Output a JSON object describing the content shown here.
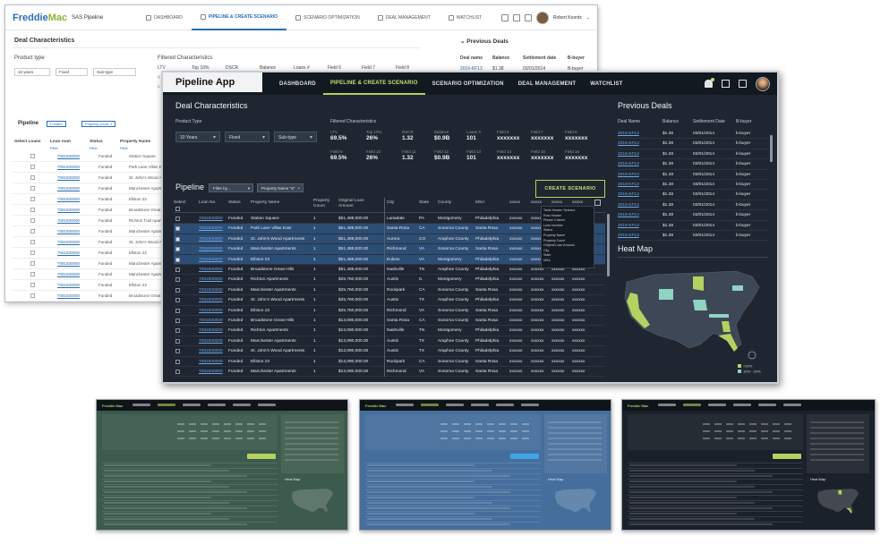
{
  "light_app": {
    "logo_a": "Freddie",
    "logo_b": "Mac",
    "app_name": "SAS Pipeline",
    "nav": [
      "DASHBOARD",
      "PIPELINE & CREATE SCENARIO",
      "SCENARIO OPTIMIZATION",
      "DEAL MANAGEMENT",
      "WATCHLIST"
    ],
    "user": "Robert Koontz",
    "deal_characteristics": "Deal Characteristics",
    "product_type": "Product type",
    "selects": [
      "10 years",
      "Fixed",
      "Sub-type"
    ],
    "filtered_characteristics": "Filtered Characteristics",
    "fc_labels": [
      "LTV",
      "Top 10%",
      "DSCR",
      "Balance",
      "Loans #",
      "Field 6",
      "Field 7",
      "Field 8"
    ],
    "previous_deals": "Previous Deals",
    "pd_headers": [
      "Deal name",
      "Balance",
      "Settlement date",
      "B-buyer"
    ],
    "pd_row": [
      "2016-KF13",
      "$1.38",
      "03/01/2014",
      "B-buyer"
    ],
    "pipeline": "Pipeline",
    "chips": [
      "Funded",
      "Property count: 1"
    ],
    "table_headers": [
      "Select Loans",
      "Loan num",
      "Status",
      "Property Name"
    ],
    "filter_label": "Filter",
    "rows": [
      {
        "ln": "7081500000",
        "st": "Funded",
        "pn": "Station Square"
      },
      {
        "ln": "7081500000",
        "st": "Funded",
        "pn": "Park Lane Villas East"
      },
      {
        "ln": "7081500000",
        "st": "Funded",
        "pn": "St. John's Wood Apartme"
      },
      {
        "ln": "7081500000",
        "st": "Funded",
        "pn": "Manchester Apartments"
      },
      {
        "ln": "7081500000",
        "st": "Funded",
        "pn": "Ellston 23"
      },
      {
        "ln": "7081500000",
        "st": "Funded",
        "pn": "Broadstone Great Hills"
      },
      {
        "ln": "7081500000",
        "st": "Funded",
        "pn": "Richton Trail Apartments"
      },
      {
        "ln": "7081500000",
        "st": "Funded",
        "pn": "Manchester Apartments"
      },
      {
        "ln": "7081500000",
        "st": "Funded",
        "pn": "St. John's Wood Apartme"
      },
      {
        "ln": "7081500000",
        "st": "Funded",
        "pn": "Ellston 23"
      },
      {
        "ln": "7081500000",
        "st": "Funded",
        "pn": "Manchester Apartments"
      },
      {
        "ln": "7081500000",
        "st": "Funded",
        "pn": "Manchester Apartments"
      },
      {
        "ln": "7081500000",
        "st": "Funded",
        "pn": "Ellston 23"
      },
      {
        "ln": "7081500000",
        "st": "Funded",
        "pn": "Broadstone Great Hills"
      }
    ]
  },
  "app": {
    "title_box": "Pipeline App",
    "nav": [
      "DASHBOARD",
      "PIPELINE & CREATE SCENARIO",
      "SCENARIO OPTIMIZATION",
      "DEAL MANAGEMENT",
      "WATCHLIST"
    ],
    "deal_characteristics": "Deal Characteristics",
    "product_type": "Product Type",
    "dropdowns": [
      "10 Years",
      "Fixed",
      "Sub-type"
    ],
    "filtered_characteristics": "Filtered Characteristics",
    "fc_row1": [
      {
        "k": "LTV",
        "v": "69.5%"
      },
      {
        "k": "Top 10%",
        "v": "26%"
      },
      {
        "k": "DSCR",
        "v": "1.32"
      },
      {
        "k": "Balance",
        "v": "$0.9B"
      },
      {
        "k": "Loans #",
        "v": "101"
      },
      {
        "k": "Field 6",
        "v": "xxxxxxx"
      },
      {
        "k": "Field 7",
        "v": "xxxxxxx"
      },
      {
        "k": "Field 8",
        "v": "xxxxxxx"
      }
    ],
    "fc_row2": [
      {
        "k": "Field 9",
        "v": "69.5%"
      },
      {
        "k": "Field 10",
        "v": "26%"
      },
      {
        "k": "Field 11",
        "v": "1.32"
      },
      {
        "k": "Field 12",
        "v": "$0.9B"
      },
      {
        "k": "Field 13",
        "v": "101"
      },
      {
        "k": "Field 14",
        "v": "xxxxxxx"
      },
      {
        "k": "Field 15",
        "v": "xxxxxxx"
      },
      {
        "k": "Field 16",
        "v": "xxxxxxx"
      }
    ],
    "pipeline": "Pipeline",
    "filter_by": "Filter by...",
    "chip": "Property Name \"S\"",
    "create_scenario": "CREATE SCENARIO",
    "headers": [
      "Select",
      "Loan No.",
      "Status",
      "Property Name",
      "Property Count",
      "Original Loan Amount",
      "City",
      "State",
      "County",
      "MSA",
      "xxxxx",
      "xxxxx",
      "xxxxx",
      "xxxxx"
    ],
    "rows": [
      {
        "sel": false,
        "ln": "7081500000",
        "st": "Funded",
        "pn": "Station Square",
        "pc": "1",
        "amt": "$51,488,000.00",
        "city": "Lanadale",
        "state": "PA",
        "county": "Montgomery",
        "msa": "Philadelphia",
        "x": "xxxxxx"
      },
      {
        "sel": true,
        "ln": "7081500000",
        "st": "Funded",
        "pn": "Park Lane Villas East",
        "pc": "1",
        "amt": "$51,488,000.00",
        "city": "Santa Rosa",
        "state": "CA",
        "county": "Sonoma County",
        "msa": "Santa Rosa",
        "x": "xxxxxx"
      },
      {
        "sel": true,
        "ln": "7081500000",
        "st": "Funded",
        "pn": "St. John's Wood Apartments",
        "pc": "1",
        "amt": "$51,488,000.00",
        "city": "Aurora",
        "state": "CO",
        "county": "Araphoe County",
        "msa": "Philadelphia",
        "x": "xxxxxx"
      },
      {
        "sel": true,
        "ln": "7081500000",
        "st": "Funded",
        "pn": "Manchester Apartments",
        "pc": "1",
        "amt": "$51,488,000.00",
        "city": "Richmond",
        "state": "VA",
        "county": "Sonoma County",
        "msa": "Santa Rosa",
        "x": "xxxxxx"
      },
      {
        "sel": true,
        "ln": "7081500000",
        "st": "Funded",
        "pn": "Ellston 23",
        "pc": "1",
        "amt": "$51,488,000.00",
        "city": "Euless",
        "state": "VA",
        "county": "Montgomery",
        "msa": "Philadelphia",
        "x": "xxxxxx"
      },
      {
        "sel": false,
        "ln": "7081500000",
        "st": "Funded",
        "pn": "Broadstone Great Hills",
        "pc": "1",
        "amt": "$51,488,000.00",
        "city": "Nashville",
        "state": "TN",
        "county": "Araphoe County",
        "msa": "Philadelphia",
        "x": "xxxxxx"
      },
      {
        "sel": false,
        "ln": "7081500000",
        "st": "Funded",
        "pn": "Richton Apartments",
        "pc": "1",
        "amt": "$25,760,000.00",
        "city": "Austin",
        "state": "IL",
        "county": "Montgomery",
        "msa": "Philadelphia",
        "x": "xxxxxx"
      },
      {
        "sel": false,
        "ln": "7081500000",
        "st": "Funded",
        "pn": "Manchester Apartments",
        "pc": "1",
        "amt": "$25,760,000.00",
        "city": "Rockpark",
        "state": "CA",
        "county": "Sonoma County",
        "msa": "Santa Rosa",
        "x": "xxxxxx"
      },
      {
        "sel": false,
        "ln": "7081500000",
        "st": "Funded",
        "pn": "St. John's Wood Apartments",
        "pc": "1",
        "amt": "$25,760,000.00",
        "city": "Austin",
        "state": "TX",
        "county": "Araphoe County",
        "msa": "Philadelphia",
        "x": "xxxxxx"
      },
      {
        "sel": false,
        "ln": "7081500000",
        "st": "Funded",
        "pn": "Ellston 23",
        "pc": "1",
        "amt": "$25,760,000.00",
        "city": "Richmond",
        "state": "VA",
        "county": "Sonoma County",
        "msa": "Santa Rosa",
        "x": "xxxxxx"
      },
      {
        "sel": false,
        "ln": "7081500000",
        "st": "Funded",
        "pn": "Broadstone Great Hills",
        "pc": "1",
        "amt": "$13,090,000.00",
        "city": "Santa Rosa",
        "state": "CA",
        "county": "Sonoma County",
        "msa": "Santa Rosa",
        "x": "xxxxxx"
      },
      {
        "sel": false,
        "ln": "7081500000",
        "st": "Funded",
        "pn": "Richton Apartments",
        "pc": "1",
        "amt": "$13,090,000.00",
        "city": "Nashville",
        "state": "TN",
        "county": "Montgomery",
        "msa": "Philadelphia",
        "x": "xxxxxx"
      },
      {
        "sel": false,
        "ln": "7081500000",
        "st": "Funded",
        "pn": "Manchester Apartments",
        "pc": "1",
        "amt": "$13,090,000.00",
        "city": "Austin",
        "state": "TX",
        "county": "Araphoe County",
        "msa": "Philadelphia",
        "x": "xxxxxx"
      },
      {
        "sel": false,
        "ln": "7081500000",
        "st": "Funded",
        "pn": "St. John's Wood Apartments",
        "pc": "1",
        "amt": "$13,090,000.00",
        "city": "Austin",
        "state": "TX",
        "county": "Araphoe County",
        "msa": "Philadelphia",
        "x": "xxxxxx"
      },
      {
        "sel": false,
        "ln": "7081500000",
        "st": "Funded",
        "pn": "Ellston 23",
        "pc": "1",
        "amt": "$13,090,000.00",
        "city": "Rockpark",
        "state": "CA",
        "county": "Sonoma County",
        "msa": "Santa Rosa",
        "x": "xxxxxx"
      },
      {
        "sel": false,
        "ln": "7081500000",
        "st": "Funded",
        "pn": "Manchester Apartments",
        "pc": "1",
        "amt": "$13,090,000.00",
        "city": "Richmond",
        "state": "VA",
        "county": "Sonoma County",
        "msa": "Santa Rosa",
        "x": "xxxxxx"
      }
    ],
    "column_menu": [
      "Table Header Selector",
      "Row Header",
      "Please Column",
      "Loan Number",
      "Status",
      "Property Name",
      "Property Count",
      "Original Loan Amount",
      "City",
      "State",
      "MSA"
    ],
    "previous_deals": "Previous Deals",
    "pd_headers": [
      "Deal Name",
      "Balance",
      "Settlement Date",
      "B-buyer"
    ],
    "pd_rows": [
      [
        "2016-KF13",
        "$1.38",
        "03/01/2014",
        "b-buyer"
      ],
      [
        "2016-KF13",
        "$1.38",
        "03/01/2014",
        "b-buyer"
      ],
      [
        "2016-KF13",
        "$1.38",
        "03/01/2014",
        "b-buyer"
      ],
      [
        "2016-KF13",
        "$1.38",
        "03/01/2014",
        "b-buyer"
      ],
      [
        "2016-KF13",
        "$1.38",
        "03/01/2014",
        "b-buyer"
      ],
      [
        "2016-KF13",
        "$1.38",
        "03/01/2014",
        "b-buyer"
      ],
      [
        "2016-KF13",
        "$1.38",
        "03/01/2014",
        "b-buyer"
      ],
      [
        "2016-KF13",
        "$1.38",
        "03/01/2014",
        "b-buyer"
      ],
      [
        "2016-KF13",
        "$1.38",
        "03/01/2014",
        "b-buyer"
      ],
      [
        "2016-KF13",
        "$1.38",
        "03/01/2014",
        "b-buyer"
      ],
      [
        "2016-KF13",
        "$1.38",
        "03/01/2014",
        "b-buyer"
      ]
    ],
    "heat_map": "Heat Map",
    "legend": [
      "<20%",
      "10% - 20%"
    ]
  },
  "thumbnails": {
    "labels": [
      "Heat Map",
      "Heat Map",
      "Heat Map"
    ],
    "colors": {
      "t1": "#3c5a4d",
      "t2": "#466e9c",
      "t3": "#1b212a",
      "accent": "#b3d25f"
    }
  }
}
